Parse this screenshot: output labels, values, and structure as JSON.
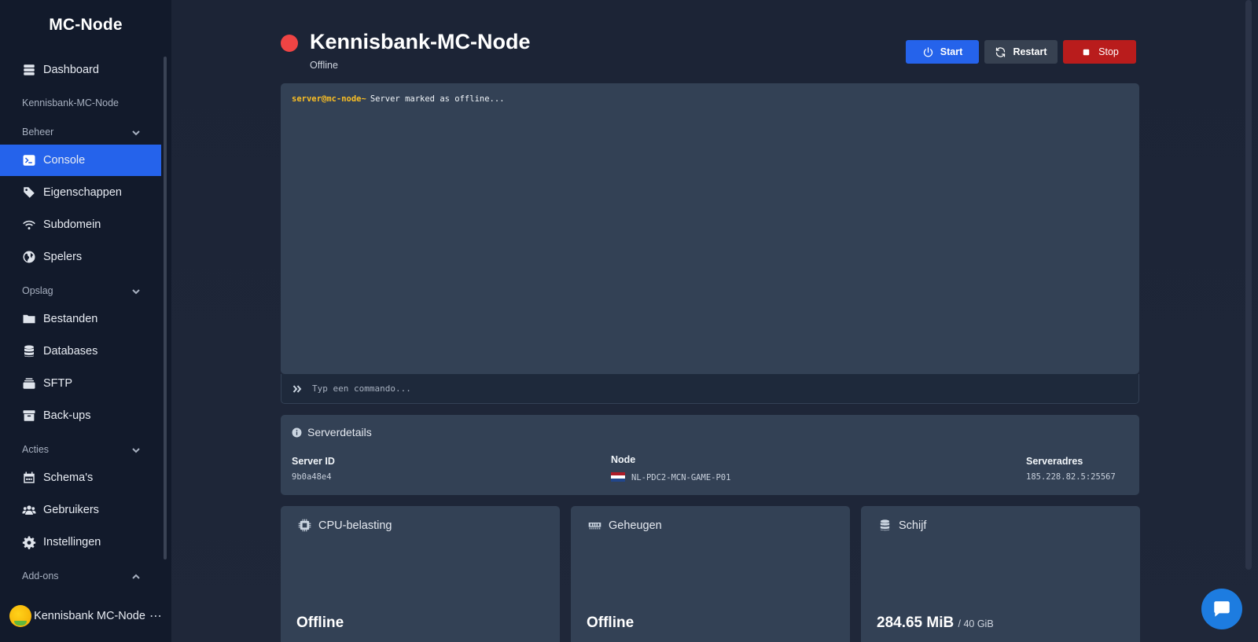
{
  "sidebar": {
    "brand": "MC-Node",
    "dashboard": "Dashboard",
    "server_name": "Kennisbank-MC-Node",
    "sections": {
      "beheer": "Beheer",
      "opslag": "Opslag",
      "acties": "Acties",
      "addons": "Add-ons"
    },
    "items": {
      "console": "Console",
      "eigenschappen": "Eigenschappen",
      "subdomein": "Subdomein",
      "spelers": "Spelers",
      "bestanden": "Bestanden",
      "databases": "Databases",
      "sftp": "SFTP",
      "backups": "Back-ups",
      "schemas": "Schema's",
      "gebruikers": "Gebruikers",
      "instellingen": "Instellingen"
    },
    "user": {
      "name": "Kennisbank MC-Node",
      "more": "⋯"
    }
  },
  "header": {
    "title": "Kennisbank-MC-Node",
    "status": "Offline",
    "status_color": "#ef4444"
  },
  "controls": {
    "start": "Start",
    "restart": "Restart",
    "stop": "Stop"
  },
  "console": {
    "prompt": "server@mc-node~",
    "message": "Server marked as offline...",
    "input_placeholder": "Typ een commando..."
  },
  "details": {
    "title": "Serverdetails",
    "server_id_label": "Server ID",
    "server_id": "9b0a48e4",
    "node_label": "Node",
    "node": "NL-PDC2-MCN-GAME-P01",
    "address_label": "Serveradres",
    "address": "185.228.82.5:25567"
  },
  "stats": {
    "cpu": {
      "title": "CPU-belasting",
      "value": "Offline"
    },
    "memory": {
      "title": "Geheugen",
      "value": "Offline"
    },
    "disk": {
      "title": "Schijf",
      "value": "284.65 MiB",
      "limit": "/ 40 GiB"
    }
  },
  "colors": {
    "accent": "#2563eb",
    "danger": "#b91c1c",
    "panel": "#334155",
    "sidebar": "#121a2b"
  }
}
